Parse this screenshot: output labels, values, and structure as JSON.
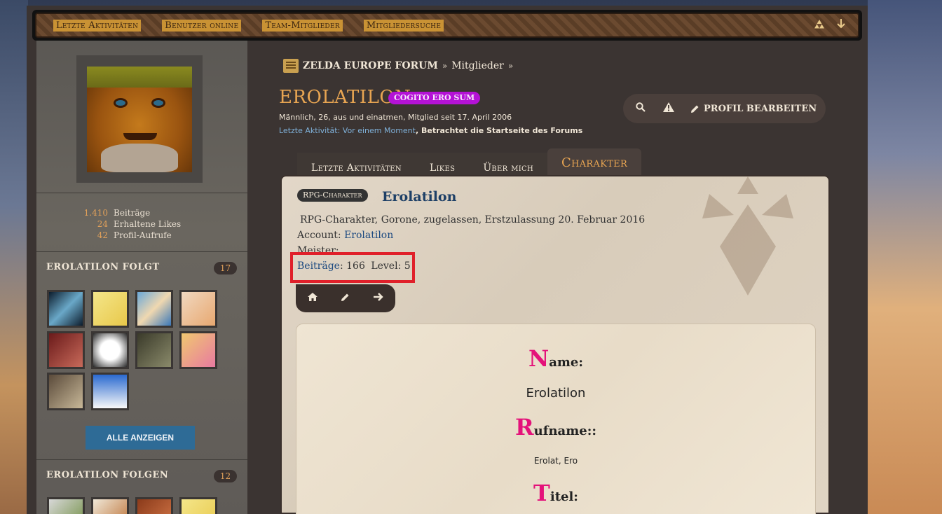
{
  "nav": {
    "items": [
      "Letzte Aktivitäten",
      "Benutzer online",
      "Team-Mitglieder",
      "Mitgliedersuche"
    ],
    "icons": [
      "triforce-icon",
      "arrow-down-icon"
    ]
  },
  "sidebar": {
    "stats": [
      {
        "value": "1.410",
        "label": "Beiträge"
      },
      {
        "value": "24",
        "label": "Erhaltene Likes"
      },
      {
        "value": "42",
        "label": "Profil-Aufrufe"
      }
    ],
    "follows": {
      "title": "EROLATILON FOLGT",
      "count": "17"
    },
    "followers": {
      "title": "EROLATILON FOLGEN",
      "count": "12"
    },
    "show_all": "ALLE ANZEIGEN"
  },
  "breadcrumb": {
    "forum": "ZELDA EUROPE FORUM",
    "sep": "»",
    "members": "Mitglieder"
  },
  "profile": {
    "username": "EROLATILON",
    "title": "COGITO ERO SUM",
    "meta": "Männlich, 26, aus und einatmen, Mitglied seit 17. April 2006",
    "activity_label": "Letzte Aktivität:",
    "activity_time": "Vor einem Moment",
    "activity_text": ", Betrachtet die Startseite des Forums",
    "edit_label": "PROFIL BEARBEITEN"
  },
  "tabs": [
    "Letzte Aktivitäten",
    "Likes",
    "Über mich",
    "Charakter"
  ],
  "character": {
    "badge": "RPG-Charakter",
    "name": "Erolatilon",
    "desc": "RPG-Charakter, Gorone, zugelassen, Erstzulassung 20. Februar 2016",
    "account_label": "Account:",
    "account_value": "Erolatilon",
    "master_label": "Meister:",
    "posts_label": "Beiträge",
    "posts_value": ": 166",
    "level_text": "Level: 5"
  },
  "fields": {
    "name_cap": "N",
    "name_rest": "ame:",
    "name_value": "Erolatilon",
    "rufname_cap": "R",
    "rufname_rest": "ufname::",
    "rufname_value": "Erolat, Ero",
    "titel_cap": "T",
    "titel_rest": "itel:"
  },
  "colors": {
    "accent": "#e8a552",
    "badge": "#b412d6",
    "link": "#1d4a80",
    "highlight": "#e0202a",
    "field_cap": "#e4127a"
  }
}
